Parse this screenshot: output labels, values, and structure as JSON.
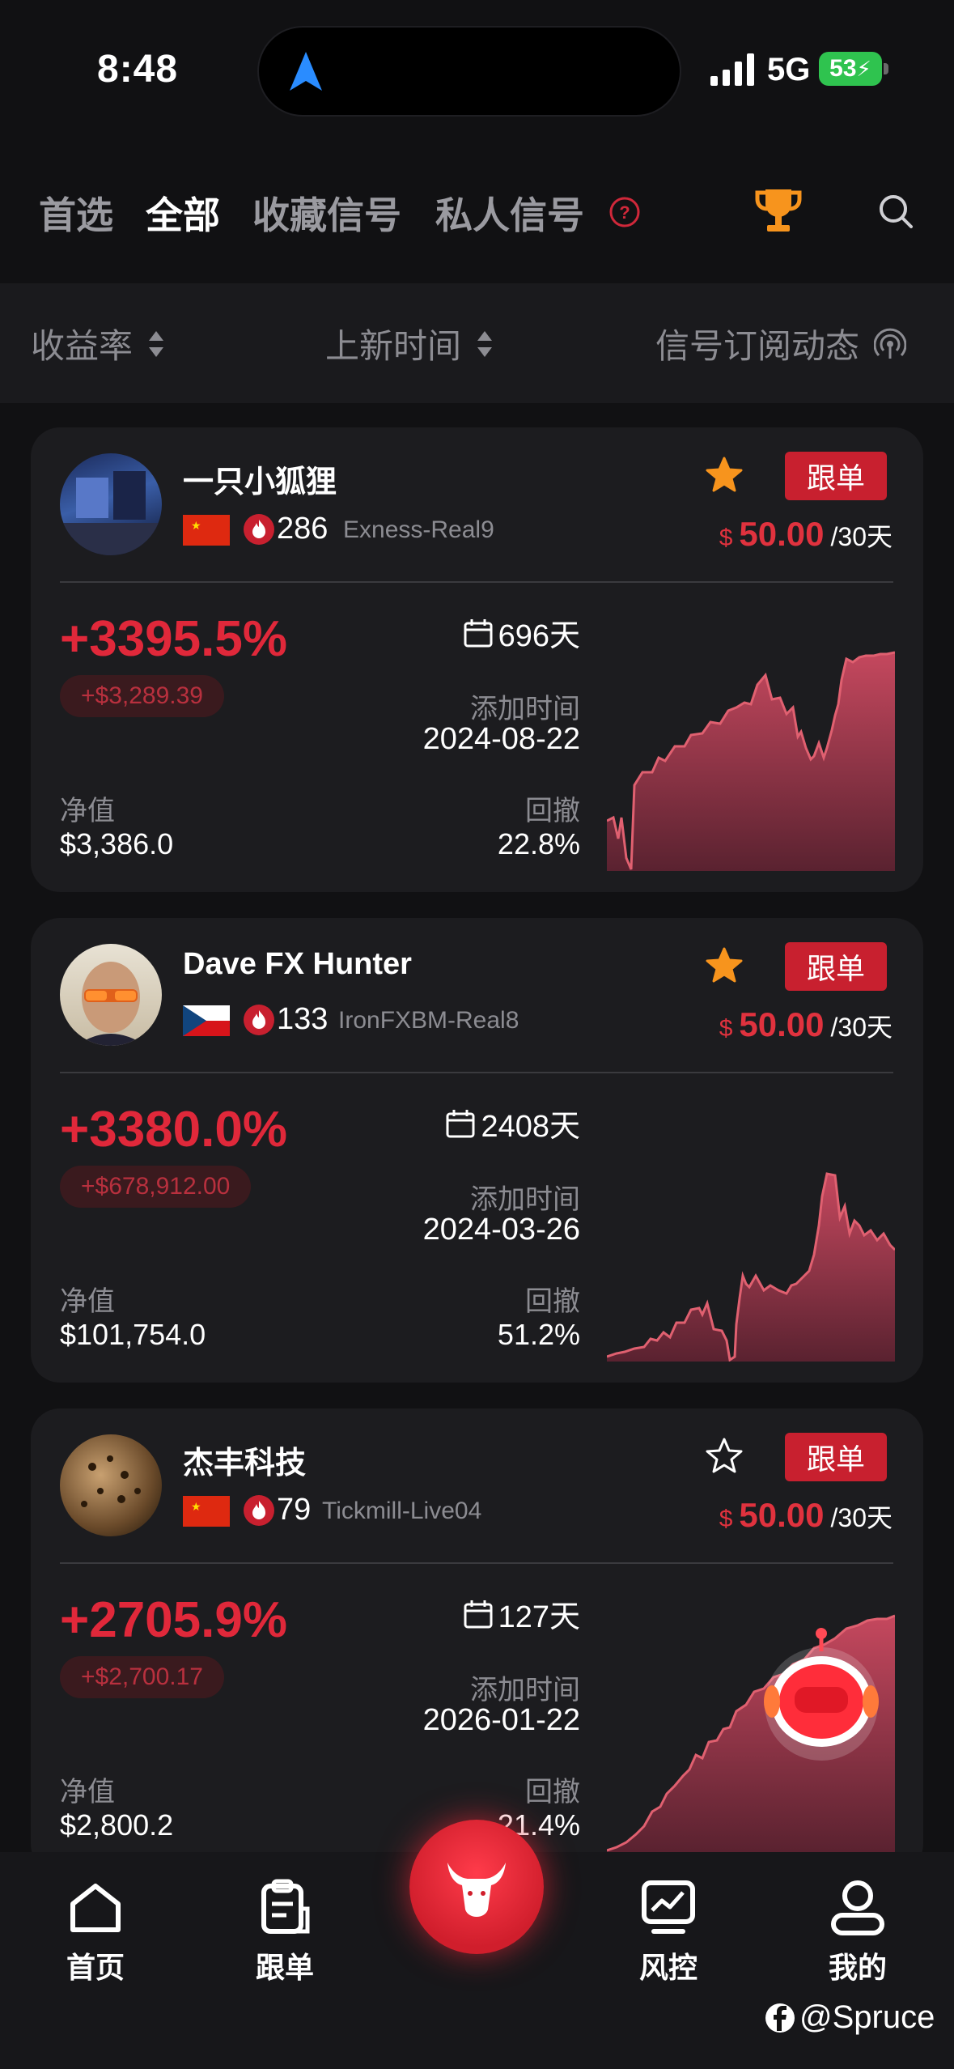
{
  "status_bar": {
    "time": "8:48",
    "network": "5G",
    "battery": "53"
  },
  "tabs": [
    {
      "label": "首选",
      "active": false
    },
    {
      "label": "全部",
      "active": true
    },
    {
      "label": "收藏信号",
      "active": false
    },
    {
      "label": "私人信号",
      "active": false
    }
  ],
  "sort_bar": {
    "yield_label": "收益率",
    "new_label": "上新时间",
    "feed_label": "信号订阅动态"
  },
  "cards": [
    {
      "name": "一只小狐狸",
      "flag": "china",
      "fans": "286",
      "server": "Exness-Real9",
      "favorited": true,
      "follow_label": "跟单",
      "price_currency": "$",
      "price": "50.00",
      "price_period": "/30天",
      "yield": "+3395.5%",
      "profit": "+$3,289.39",
      "days": "696天",
      "added_label": "添加时间",
      "added_date": "2024-08-22",
      "nav_label": "净值",
      "nav_value": "$3,386.0",
      "drawdown_label": "回撤",
      "drawdown_value": "22.8%"
    },
    {
      "name": "Dave FX Hunter",
      "flag": "czech",
      "fans": "133",
      "server": "IronFXBM-Real8",
      "favorited": true,
      "follow_label": "跟单",
      "price_currency": "$",
      "price": "50.00",
      "price_period": "/30天",
      "yield": "+3380.0%",
      "profit": "+$678,912.00",
      "days": "2408天",
      "added_label": "添加时间",
      "added_date": "2024-03-26",
      "nav_label": "净值",
      "nav_value": "$101,754.0",
      "drawdown_label": "回撤",
      "drawdown_value": "51.2%"
    },
    {
      "name": "杰丰科技",
      "flag": "china",
      "fans": "79",
      "server": "Tickmill-Live04",
      "favorited": false,
      "follow_label": "跟单",
      "price_currency": "$",
      "price": "50.00",
      "price_period": "/30天",
      "yield": "+2705.9%",
      "profit": "+$2,700.17",
      "days": "127天",
      "added_label": "添加时间",
      "added_date": "2026-01-22",
      "nav_label": "净值",
      "nav_value": "$2,800.2",
      "drawdown_label": "回撤",
      "drawdown_value": "21.4%"
    }
  ],
  "bottom_nav": [
    {
      "label": "首页",
      "icon": "home-icon"
    },
    {
      "label": "跟单",
      "icon": "clipboard-icon"
    },
    {
      "label": "风控",
      "icon": "chart-monitor-icon"
    },
    {
      "label": "我的",
      "icon": "user-icon"
    }
  ],
  "watermark": "@Spruce",
  "colors": {
    "accent_red": "#e0283a",
    "button_red": "#c8202f",
    "star_orange": "#f7941d",
    "bg": "#111113",
    "card": "#1c1c1f"
  }
}
